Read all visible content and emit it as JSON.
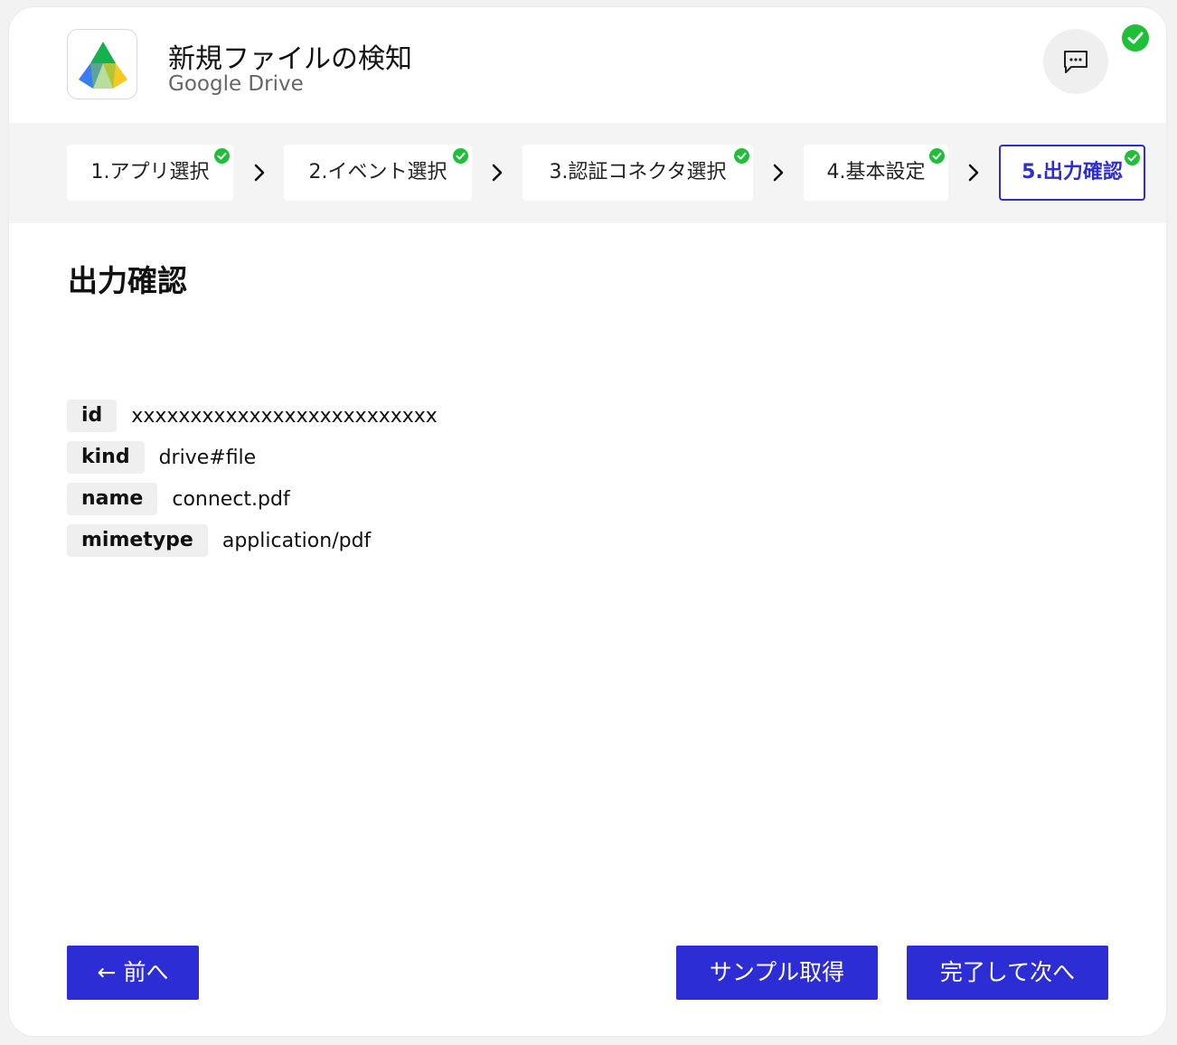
{
  "app": {
    "title": "新規ファイルの検知",
    "subtitle": "Google Drive"
  },
  "steps": [
    {
      "label": "1.アプリ選択",
      "done": true
    },
    {
      "label": "2.イベント選択",
      "done": true
    },
    {
      "label": "3.認証コネクタ選択",
      "done": true
    },
    {
      "label": "4.基本設定",
      "done": true
    },
    {
      "label": "5.出力確認",
      "done": true,
      "active": true
    }
  ],
  "section": {
    "title": "出力確認"
  },
  "fields": [
    {
      "key": "id",
      "value": "xxxxxxxxxxxxxxxxxxxxxxxxxx"
    },
    {
      "key": "kind",
      "value": "drive#file"
    },
    {
      "key": "name",
      "value": "connect.pdf"
    },
    {
      "key": "mimetype",
      "value": "application/pdf"
    }
  ],
  "buttons": {
    "back": "← 前へ",
    "sample": "サンプル取得",
    "finish": "完了して次へ"
  },
  "colors": {
    "accent": "#2d2dd6",
    "success": "#1fbf3a"
  },
  "icons": {
    "app": "google-drive-logo",
    "chat": "chat-bubble-icon",
    "status": "check-circle-icon"
  }
}
